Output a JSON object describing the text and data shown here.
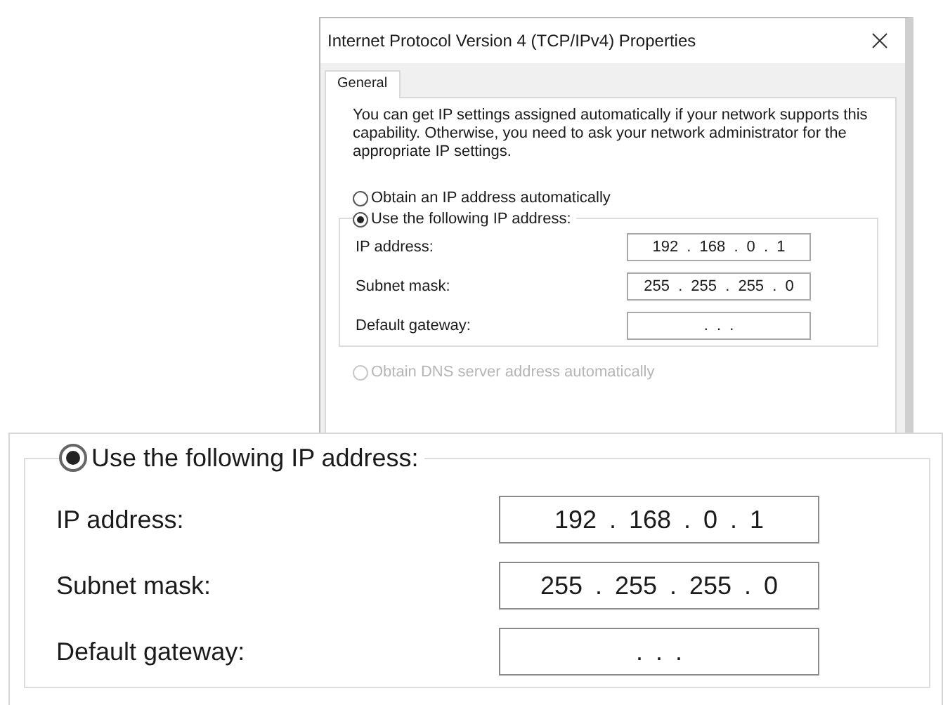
{
  "dialog": {
    "title": "Internet Protocol Version 4 (TCP/IPv4) Properties",
    "tabs": [
      {
        "label": "General",
        "selected": true
      }
    ],
    "description": "You can get IP settings assigned automatically if your network supports this capability. Otherwise, you need to ask your network administrator for the appropriate IP settings.",
    "ip_options": [
      {
        "label": "Obtain an IP address automatically",
        "selected": false
      },
      {
        "label": "Use the following IP address:",
        "selected": true
      }
    ],
    "ip_fields": [
      {
        "label": "IP address:",
        "value": "192 . 168 . 0 . 1"
      },
      {
        "label": "Subnet mask:",
        "value": "255 . 255 . 255 . 0"
      },
      {
        "label": "Default gateway:",
        "value": ". . ."
      }
    ],
    "dns_options": [
      {
        "label": "Obtain DNS server address automatically",
        "selected": false,
        "disabled": true
      }
    ]
  },
  "zoom_inset": {
    "option": {
      "label": "Use the following IP address:",
      "selected": true
    },
    "fields": [
      {
        "label": "IP address:",
        "value": "192 . 168 . 0 . 1"
      },
      {
        "label": "Subnet mask:",
        "value": "255 . 255 . 255 . 0"
      },
      {
        "label": "Default gateway:",
        "value": ". . ."
      }
    ]
  }
}
